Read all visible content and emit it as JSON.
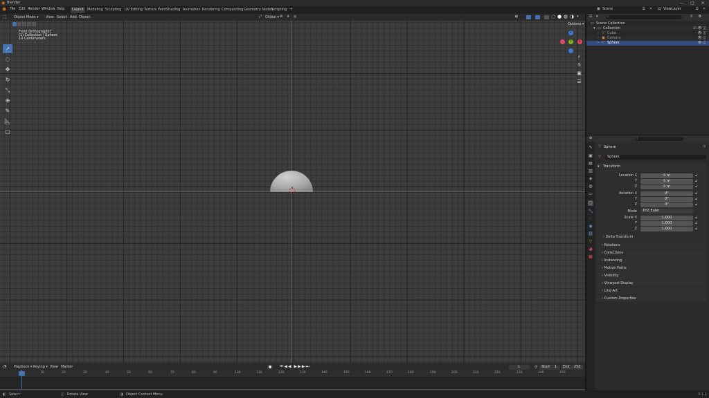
{
  "window": {
    "title": "Blender",
    "controls": [
      "—",
      "□",
      "✕"
    ]
  },
  "menu": [
    "File",
    "Edit",
    "Render",
    "Window",
    "Help"
  ],
  "workspaces": [
    "Layout",
    "Modeling",
    "Sculpting",
    "UV Editing",
    "Texture Paint",
    "Shading",
    "Animation",
    "Rendering",
    "Compositing",
    "Geometry Nodes",
    "Scripting"
  ],
  "active_workspace": 0,
  "scene": {
    "name": "Scene",
    "view_layer": "ViewLayer"
  },
  "viewport": {
    "mode": "Object Mode",
    "menus": [
      "View",
      "Select",
      "Add",
      "Object"
    ],
    "transform_orientation": "Global",
    "options_label": "Options",
    "overlay_lines": [
      "Front Orthographic",
      "(1) Collection | Sphere",
      "10 Centimeters"
    ],
    "axes": [
      "X",
      "Y",
      "Z"
    ]
  },
  "outliner": {
    "rows": [
      {
        "label": "Scene Collection",
        "indent": 0
      },
      {
        "label": "Collection",
        "indent": 1
      },
      {
        "label": "Cube",
        "indent": 2
      },
      {
        "label": "Camera",
        "indent": 2
      },
      {
        "label": "Sphere",
        "indent": 2
      }
    ]
  },
  "properties": {
    "object_name": "Sphere",
    "object_field": "Sphere",
    "transform": {
      "title": "Transform",
      "location_label": "Location X",
      "location": [
        "0 m",
        "0 m",
        "0 m"
      ],
      "rotation_label": "Rotation X",
      "rotation": [
        "0°",
        "0°",
        "0°"
      ],
      "mode_label": "Mode",
      "mode": "XYZ Euler",
      "scale_label": "Scale X",
      "scale": [
        "1.000",
        "1.000",
        "1.000"
      ],
      "y_label": "Y",
      "z_label": "Z",
      "delta": "Delta Transform"
    },
    "sections": [
      "Relations",
      "Collections",
      "Instancing",
      "Motion Paths",
      "Visibility",
      "Viewport Display",
      "Line Art",
      "Custom Properties"
    ]
  },
  "timeline": {
    "menus": [
      "Playback",
      "Keying",
      "View",
      "Marker"
    ],
    "current_frame": "1",
    "start_label": "Start",
    "start": "1",
    "end_label": "End",
    "end": "250",
    "ticks": [
      "1",
      "10",
      "20",
      "30",
      "40",
      "50",
      "60",
      "70",
      "80",
      "90",
      "100",
      "110",
      "120",
      "130",
      "140",
      "150",
      "160",
      "170",
      "180",
      "190",
      "200",
      "210",
      "220",
      "230",
      "240",
      "250"
    ]
  },
  "status": {
    "left": "Select",
    "middle": "Rotate View",
    "right": "Object Context Menu",
    "version": "3.1.2"
  },
  "colors": {
    "accent": "#4772b3",
    "x_axis": "#e0485b",
    "y_axis": "#86b21d",
    "z_axis": "#3f7ad8"
  }
}
